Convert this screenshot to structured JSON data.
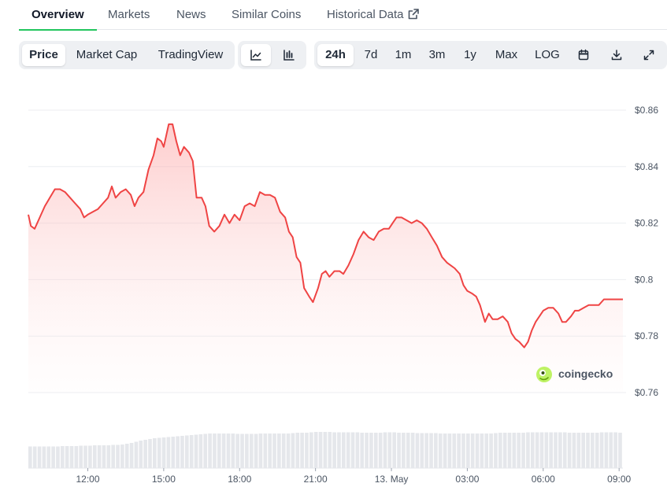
{
  "tabs": [
    {
      "label": "Overview",
      "active": true
    },
    {
      "label": "Markets"
    },
    {
      "label": "News"
    },
    {
      "label": "Similar Coins"
    },
    {
      "label": "Historical Data",
      "icon": "external-link-icon"
    }
  ],
  "chart_type_toggle": {
    "items": [
      "Price",
      "Market Cap",
      "TradingView"
    ],
    "selected": "Price"
  },
  "view_toggle": {
    "items": [
      {
        "icon": "line-chart-icon",
        "selected": true
      },
      {
        "icon": "candlestick-chart-icon"
      }
    ]
  },
  "range_toggle": {
    "items": [
      "24h",
      "7d",
      "1m",
      "3m",
      "1y",
      "Max",
      "LOG"
    ],
    "selected": "24h"
  },
  "tool_icons": [
    "calendar-icon",
    "download-icon",
    "expand-icon"
  ],
  "watermark": "coingecko",
  "colors": {
    "line": "#ef4444",
    "fill": "#fecaca",
    "volume": "#e5e7eb",
    "active_tab": "#22c55e"
  },
  "chart_data": {
    "type": "area",
    "ylim": [
      0.75,
      0.87
    ],
    "y_ticks": [
      {
        "value": 0.86,
        "label": "$0.86"
      },
      {
        "value": 0.84,
        "label": "$0.84"
      },
      {
        "value": 0.82,
        "label": "$0.82"
      },
      {
        "value": 0.8,
        "label": "$0.8"
      },
      {
        "value": 0.78,
        "label": "$0.78"
      },
      {
        "value": 0.76,
        "label": "$0.76"
      }
    ],
    "x_ticks": [
      {
        "hour": 2,
        "label": "12:00"
      },
      {
        "hour": 5,
        "label": "15:00"
      },
      {
        "hour": 8,
        "label": "18:00"
      },
      {
        "hour": 11,
        "label": "21:00"
      },
      {
        "hour": 14,
        "label": "13. May"
      },
      {
        "hour": 17,
        "label": "03:00"
      },
      {
        "hour": 20,
        "label": "06:00"
      },
      {
        "hour": 23,
        "label": "09:00"
      }
    ],
    "x_range_hours": [
      -0.35,
      23.15
    ],
    "grid": true,
    "series": [
      {
        "values": [
          [
            -0.35,
            0.823
          ],
          [
            -0.25,
            0.819
          ],
          [
            -0.1,
            0.818
          ],
          [
            0.1,
            0.822
          ],
          [
            0.3,
            0.826
          ],
          [
            0.5,
            0.829
          ],
          [
            0.7,
            0.832
          ],
          [
            0.9,
            0.832
          ],
          [
            1.1,
            0.831
          ],
          [
            1.3,
            0.829
          ],
          [
            1.5,
            0.827
          ],
          [
            1.7,
            0.825
          ],
          [
            1.85,
            0.822
          ],
          [
            2.0,
            0.823
          ],
          [
            2.2,
            0.824
          ],
          [
            2.4,
            0.825
          ],
          [
            2.6,
            0.827
          ],
          [
            2.8,
            0.829
          ],
          [
            2.95,
            0.833
          ],
          [
            3.1,
            0.829
          ],
          [
            3.3,
            0.831
          ],
          [
            3.5,
            0.832
          ],
          [
            3.7,
            0.83
          ],
          [
            3.85,
            0.826
          ],
          [
            4.0,
            0.829
          ],
          [
            4.2,
            0.831
          ],
          [
            4.4,
            0.839
          ],
          [
            4.6,
            0.844
          ],
          [
            4.75,
            0.85
          ],
          [
            4.9,
            0.849
          ],
          [
            5.0,
            0.847
          ],
          [
            5.1,
            0.851
          ],
          [
            5.2,
            0.855
          ],
          [
            5.35,
            0.855
          ],
          [
            5.5,
            0.849
          ],
          [
            5.65,
            0.844
          ],
          [
            5.8,
            0.847
          ],
          [
            6.0,
            0.845
          ],
          [
            6.15,
            0.842
          ],
          [
            6.3,
            0.829
          ],
          [
            6.5,
            0.829
          ],
          [
            6.65,
            0.826
          ],
          [
            6.8,
            0.819
          ],
          [
            7.0,
            0.817
          ],
          [
            7.2,
            0.819
          ],
          [
            7.4,
            0.823
          ],
          [
            7.6,
            0.82
          ],
          [
            7.8,
            0.823
          ],
          [
            8.0,
            0.821
          ],
          [
            8.2,
            0.826
          ],
          [
            8.4,
            0.827
          ],
          [
            8.6,
            0.826
          ],
          [
            8.8,
            0.831
          ],
          [
            9.0,
            0.83
          ],
          [
            9.2,
            0.83
          ],
          [
            9.4,
            0.829
          ],
          [
            9.6,
            0.824
          ],
          [
            9.8,
            0.822
          ],
          [
            9.95,
            0.817
          ],
          [
            10.1,
            0.815
          ],
          [
            10.25,
            0.808
          ],
          [
            10.4,
            0.806
          ],
          [
            10.55,
            0.797
          ],
          [
            10.75,
            0.794
          ],
          [
            10.9,
            0.792
          ],
          [
            11.1,
            0.797
          ],
          [
            11.25,
            0.802
          ],
          [
            11.4,
            0.803
          ],
          [
            11.55,
            0.801
          ],
          [
            11.75,
            0.803
          ],
          [
            11.95,
            0.803
          ],
          [
            12.1,
            0.802
          ],
          [
            12.3,
            0.805
          ],
          [
            12.5,
            0.809
          ],
          [
            12.7,
            0.814
          ],
          [
            12.9,
            0.817
          ],
          [
            13.1,
            0.815
          ],
          [
            13.3,
            0.814
          ],
          [
            13.5,
            0.817
          ],
          [
            13.7,
            0.818
          ],
          [
            13.9,
            0.818
          ],
          [
            14.05,
            0.82
          ],
          [
            14.2,
            0.822
          ],
          [
            14.4,
            0.822
          ],
          [
            14.6,
            0.821
          ],
          [
            14.8,
            0.82
          ],
          [
            15.0,
            0.821
          ],
          [
            15.2,
            0.82
          ],
          [
            15.4,
            0.818
          ],
          [
            15.6,
            0.815
          ],
          [
            15.8,
            0.812
          ],
          [
            16.0,
            0.808
          ],
          [
            16.2,
            0.806
          ],
          [
            16.35,
            0.805
          ],
          [
            16.5,
            0.804
          ],
          [
            16.7,
            0.802
          ],
          [
            16.85,
            0.798
          ],
          [
            17.0,
            0.796
          ],
          [
            17.2,
            0.795
          ],
          [
            17.35,
            0.794
          ],
          [
            17.5,
            0.791
          ],
          [
            17.6,
            0.788
          ],
          [
            17.7,
            0.785
          ],
          [
            17.85,
            0.788
          ],
          [
            18.0,
            0.786
          ],
          [
            18.2,
            0.786
          ],
          [
            18.4,
            0.787
          ],
          [
            18.6,
            0.785
          ],
          [
            18.75,
            0.781
          ],
          [
            18.9,
            0.779
          ],
          [
            19.05,
            0.778
          ],
          [
            19.25,
            0.776
          ],
          [
            19.4,
            0.778
          ],
          [
            19.55,
            0.782
          ],
          [
            19.7,
            0.785
          ],
          [
            19.85,
            0.787
          ],
          [
            20.0,
            0.789
          ],
          [
            20.2,
            0.79
          ],
          [
            20.4,
            0.79
          ],
          [
            20.6,
            0.788
          ],
          [
            20.75,
            0.785
          ],
          [
            20.9,
            0.785
          ],
          [
            21.1,
            0.787
          ],
          [
            21.25,
            0.789
          ],
          [
            21.4,
            0.789
          ],
          [
            21.6,
            0.79
          ],
          [
            21.8,
            0.791
          ],
          [
            22.0,
            0.791
          ],
          [
            22.2,
            0.791
          ],
          [
            22.4,
            0.793
          ],
          [
            22.6,
            0.793
          ],
          [
            22.8,
            0.793
          ],
          [
            23.0,
            0.793
          ],
          [
            23.15,
            0.793
          ]
        ]
      }
    ],
    "volume": {
      "x_range_hours": [
        -0.35,
        23.15
      ],
      "values": [
        0.55,
        0.55,
        0.55,
        0.55,
        0.55,
        0.55,
        0.55,
        0.56,
        0.56,
        0.56,
        0.56,
        0.57,
        0.57,
        0.57,
        0.58,
        0.58,
        0.58,
        0.58,
        0.59,
        0.59,
        0.6,
        0.62,
        0.64,
        0.67,
        0.7,
        0.72,
        0.74,
        0.76,
        0.77,
        0.78,
        0.79,
        0.8,
        0.81,
        0.82,
        0.83,
        0.84,
        0.85,
        0.86,
        0.87,
        0.88,
        0.88,
        0.88,
        0.88,
        0.88,
        0.88,
        0.87,
        0.87,
        0.87,
        0.87,
        0.87,
        0.88,
        0.88,
        0.88,
        0.88,
        0.88,
        0.88,
        0.88,
        0.89,
        0.9,
        0.9,
        0.9,
        0.91,
        0.92,
        0.92,
        0.92,
        0.92,
        0.91,
        0.91,
        0.91,
        0.91,
        0.91,
        0.91,
        0.9,
        0.9,
        0.9,
        0.9,
        0.9,
        0.91,
        0.91,
        0.91,
        0.9,
        0.9,
        0.9,
        0.9,
        0.89,
        0.89,
        0.89,
        0.89,
        0.89,
        0.88,
        0.88,
        0.88,
        0.88,
        0.88,
        0.88,
        0.88,
        0.88,
        0.88,
        0.88,
        0.88,
        0.88,
        0.89,
        0.9,
        0.9,
        0.9,
        0.9,
        0.9,
        0.9,
        0.91,
        0.91,
        0.91,
        0.91,
        0.91,
        0.91,
        0.91,
        0.91,
        0.91,
        0.9,
        0.9,
        0.9,
        0.9,
        0.9,
        0.9,
        0.9,
        0.91,
        0.91,
        0.91,
        0.91,
        0.9
      ]
    }
  }
}
